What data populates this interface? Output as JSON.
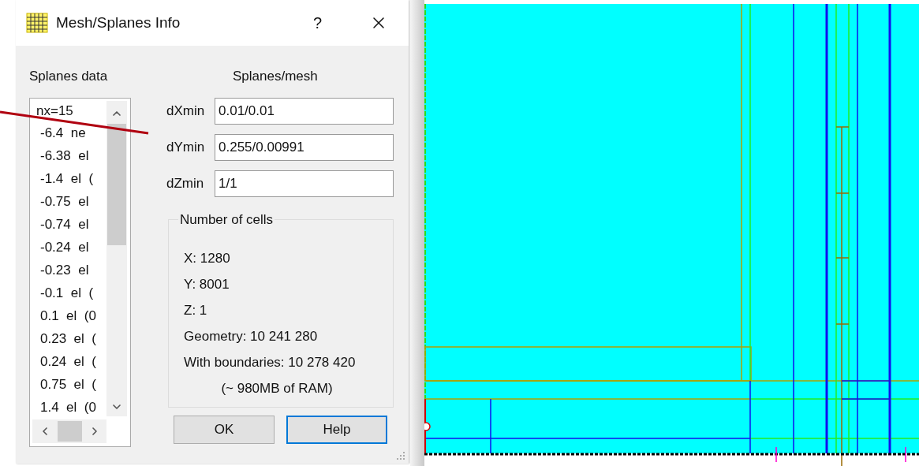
{
  "dialog": {
    "title": "Mesh/Splanes Info",
    "help_button": "?",
    "splanes_data": {
      "label": "Splanes data",
      "list": {
        "header": "nx=15",
        "children": [
          {
            "text": "-6.4  ne"
          },
          {
            "text": "-6.38  el"
          },
          {
            "text": "-1.4  el  ("
          },
          {
            "text": "-0.75  el"
          },
          {
            "text": "-0.74  el"
          },
          {
            "text": "-0.24  el"
          },
          {
            "text": "-0.23  el"
          },
          {
            "text": "-0.1  el  ("
          },
          {
            "text": "0.1  el  (0"
          },
          {
            "text": "0.23  el  ("
          },
          {
            "text": "0.24  el  ("
          },
          {
            "text": "0.75  el  ("
          },
          {
            "text": "1.4  el  (0"
          }
        ]
      }
    },
    "splanes_mesh": {
      "label": "Splanes/mesh",
      "fields": [
        {
          "label": "dXmin",
          "value": "0.01/0.01"
        },
        {
          "label": "dYmin",
          "value": "0.255/0.00991"
        },
        {
          "label": "dZmin",
          "value": "1/1"
        }
      ]
    },
    "number_of_cells": {
      "title": "Number of cells",
      "lines": [
        "X: 1280",
        "Y: 8001",
        "Z: 1",
        "Geometry: 10 241 280",
        "With boundaries: 10 278 420"
      ],
      "note": "(~ 980MB of RAM)"
    },
    "buttons": [
      {
        "label": "OK",
        "default": false
      },
      {
        "label": "Help",
        "default": true
      }
    ]
  }
}
